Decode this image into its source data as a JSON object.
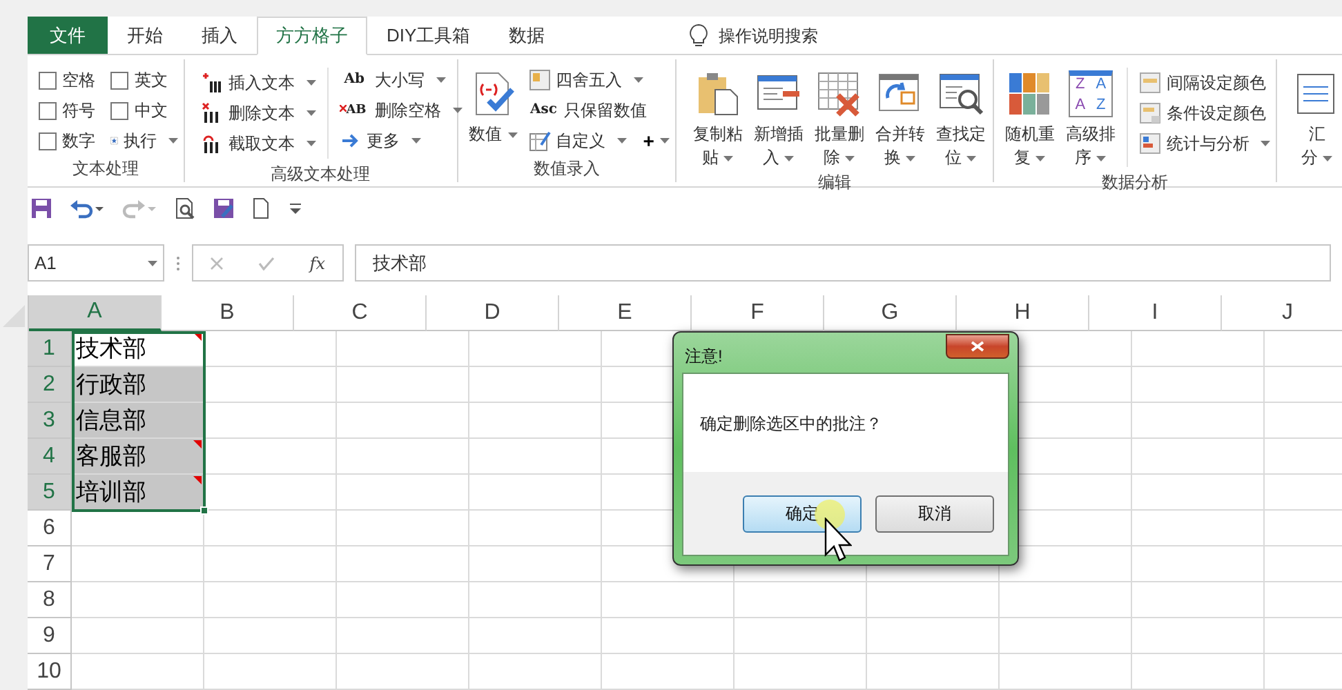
{
  "tabs": [
    {
      "label": "文件",
      "kind": "file",
      "selected": false
    },
    {
      "label": "开始",
      "kind": "tab",
      "selected": false
    },
    {
      "label": "插入",
      "kind": "tab",
      "selected": false
    },
    {
      "label": "方方格子",
      "kind": "tab",
      "selected": true
    },
    {
      "label": "DIY工具箱",
      "kind": "tab",
      "selected": false
    },
    {
      "label": "数据",
      "kind": "tab",
      "selected": false
    }
  ],
  "tell_me": "操作说明搜索",
  "ribbon": [
    {
      "title": "文本处理",
      "kind": "checks",
      "items": [
        {
          "label": "空格",
          "checked": false
        },
        {
          "label": "英文",
          "checked": false
        },
        {
          "label": "符号",
          "checked": false
        },
        {
          "label": "中文",
          "checked": false
        },
        {
          "label": "数字",
          "checked": false
        }
      ],
      "action": "执行"
    },
    {
      "title": "高级文本处理",
      "kind": "lists",
      "items": [
        {
          "label": "插入文本"
        },
        {
          "label": "删除文本"
        },
        {
          "label": "截取文本"
        },
        {
          "label": "大小写",
          "icon_text": "Ab"
        },
        {
          "label": "删除空格",
          "icon_text": "AB"
        },
        {
          "label": "更多"
        }
      ]
    },
    {
      "title": "数值录入",
      "kind": "numbers",
      "big": {
        "lines": [
          "数值"
        ]
      },
      "items": [
        {
          "label": "四舍五入"
        },
        {
          "label": "只保留数值",
          "icon_text": "Asc"
        },
        {
          "label": "自定义"
        }
      ],
      "plus": "+"
    },
    {
      "title": "编辑",
      "kind": "bigs",
      "items": [
        {
          "lines": [
            "复制粘",
            "贴"
          ]
        },
        {
          "lines": [
            "新增插",
            "入"
          ]
        },
        {
          "lines": [
            "批量删",
            "除"
          ]
        },
        {
          "lines": [
            "合并转",
            "换"
          ]
        },
        {
          "lines": [
            "查找定",
            "位"
          ]
        }
      ]
    },
    {
      "title": "数据分析",
      "kind": "analysis",
      "items": [
        {
          "lines": [
            "随机重",
            "复"
          ]
        },
        {
          "lines": [
            "高级排",
            "序"
          ],
          "icon_letters": [
            "Z",
            "A",
            "A",
            "Z"
          ]
        }
      ],
      "list": [
        {
          "label": "间隔设定颜色",
          "caret": false
        },
        {
          "label": "条件设定颜色",
          "caret": false
        },
        {
          "label": "统计与分析",
          "caret": true
        }
      ]
    },
    {
      "kind": "cut",
      "items": [
        {
          "lines": [
            "汇",
            "分"
          ]
        }
      ]
    }
  ],
  "quick_access": [
    {
      "kind": "save",
      "disabled": false
    },
    {
      "kind": "undo",
      "disabled": false
    },
    {
      "kind": "redo",
      "disabled": true
    },
    {
      "kind": "preview",
      "disabled": false
    },
    {
      "kind": "saveedit",
      "disabled": false
    },
    {
      "kind": "new",
      "disabled": false
    },
    {
      "kind": "customize",
      "disabled": false
    }
  ],
  "formula_bar": {
    "name_box": "A1",
    "function_label": "fx",
    "value": "技术部"
  },
  "sheet": {
    "columns": [
      {
        "label": "A",
        "selected": true
      },
      {
        "label": "B",
        "selected": false
      },
      {
        "label": "C",
        "selected": false
      },
      {
        "label": "D",
        "selected": false
      },
      {
        "label": "E",
        "selected": false
      },
      {
        "label": "F",
        "selected": false
      },
      {
        "label": "G",
        "selected": false
      },
      {
        "label": "H",
        "selected": false
      },
      {
        "label": "I",
        "selected": false
      },
      {
        "label": "J",
        "selected": false
      }
    ],
    "rows": [
      {
        "label": "1",
        "selected": true,
        "value": "技术部",
        "comment": true,
        "active": true
      },
      {
        "label": "2",
        "selected": true,
        "value": "行政部",
        "comment": false,
        "active": false
      },
      {
        "label": "3",
        "selected": true,
        "value": "信息部",
        "comment": false,
        "active": false
      },
      {
        "label": "4",
        "selected": true,
        "value": "客服部",
        "comment": true,
        "active": false
      },
      {
        "label": "5",
        "selected": true,
        "value": "培训部",
        "comment": true,
        "active": false
      },
      {
        "label": "6",
        "selected": false
      },
      {
        "label": "7",
        "selected": false
      },
      {
        "label": "8",
        "selected": false
      },
      {
        "label": "9",
        "selected": false
      },
      {
        "label": "10",
        "selected": false
      }
    ]
  },
  "dialog": {
    "title": "注意!",
    "message": "确定删除选区中的批注？",
    "buttons": [
      {
        "label": "确定",
        "selected": true
      },
      {
        "label": "取消",
        "selected": false
      }
    ]
  }
}
